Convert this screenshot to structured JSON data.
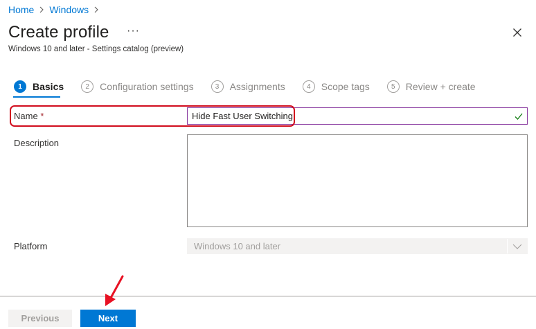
{
  "breadcrumb": {
    "items": [
      "Home",
      "Windows"
    ]
  },
  "header": {
    "title": "Create profile",
    "more_label": "···",
    "subtitle": "Windows 10 and later - Settings catalog (preview)"
  },
  "steps": [
    {
      "num": "1",
      "label": "Basics",
      "active": true
    },
    {
      "num": "2",
      "label": "Configuration settings",
      "active": false
    },
    {
      "num": "3",
      "label": "Assignments",
      "active": false
    },
    {
      "num": "4",
      "label": "Scope tags",
      "active": false
    },
    {
      "num": "5",
      "label": "Review + create",
      "active": false
    }
  ],
  "form": {
    "name_label": "Name",
    "required_marker": "*",
    "name_value": "Hide Fast User Switching",
    "description_label": "Description",
    "description_value": "",
    "platform_label": "Platform",
    "platform_value": "Windows 10 and later"
  },
  "footer": {
    "previous_label": "Previous",
    "next_label": "Next"
  },
  "colors": {
    "accent": "#0078d4",
    "annotation": "#d10c1d",
    "valid": "#107c10"
  },
  "icons": [
    "chevron-right-icon",
    "more-icon",
    "close-icon",
    "checkmark-icon",
    "chevron-down-icon",
    "annotation-arrow-icon"
  ]
}
